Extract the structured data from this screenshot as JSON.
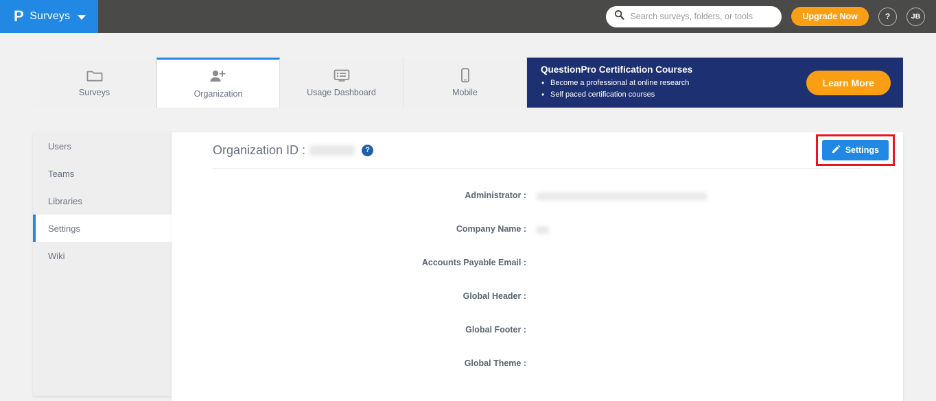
{
  "topbar": {
    "brand_logo": "P",
    "brand_title": "Surveys",
    "search": {
      "icon": "search-icon",
      "placeholder": "Search surveys, folders, or tools",
      "value": ""
    },
    "upgrade_label": "Upgrade Now",
    "help_label": "?",
    "avatar_initials": "JB",
    "bar_color": "#4a4a48",
    "brand_color": "#2189e3",
    "accent_color": "#fa9e14"
  },
  "tabs": [
    {
      "label": "Surveys",
      "icon": "folder-icon",
      "active": false
    },
    {
      "label": "Organization",
      "icon": "add-user-icon",
      "active": true
    },
    {
      "label": "Usage Dashboard",
      "icon": "dashboard-icon",
      "active": false
    },
    {
      "label": "Mobile",
      "icon": "mobile-phone-icon",
      "active": false
    }
  ],
  "banner": {
    "title": "QuestionPro Certification Courses",
    "bullets": [
      "Become a professional at online research",
      "Self paced certification courses"
    ],
    "button_label": "Learn More",
    "background_color": "#1d3072",
    "button_color": "#fa9e14"
  },
  "sidebar": {
    "items": [
      {
        "label": "Users",
        "active": false
      },
      {
        "label": "Teams",
        "active": false
      },
      {
        "label": "Libraries",
        "active": false
      },
      {
        "label": "Settings",
        "active": true
      },
      {
        "label": "Wiki",
        "active": false
      }
    ],
    "active_indicator_color": "#2189e3"
  },
  "main": {
    "org_id_label": "Organization ID :",
    "org_id_value": "",
    "org_id_redacted": true,
    "help_icon_label": "?",
    "settings_button": {
      "label": "Settings",
      "icon": "pencil-icon",
      "color": "#2189e3",
      "highlight_color": "#e8161f"
    },
    "fields": [
      {
        "label": "Administrator :",
        "value": "",
        "redacted": "admin"
      },
      {
        "label": "Company Name :",
        "value": "",
        "redacted": "company"
      },
      {
        "label": "Accounts Payable Email :",
        "value": "",
        "redacted": "none"
      },
      {
        "label": "Global Header :",
        "value": "",
        "redacted": "none"
      },
      {
        "label": "Global Footer :",
        "value": "",
        "redacted": "none"
      },
      {
        "label": "Global Theme :",
        "value": "",
        "redacted": "none"
      }
    ]
  }
}
